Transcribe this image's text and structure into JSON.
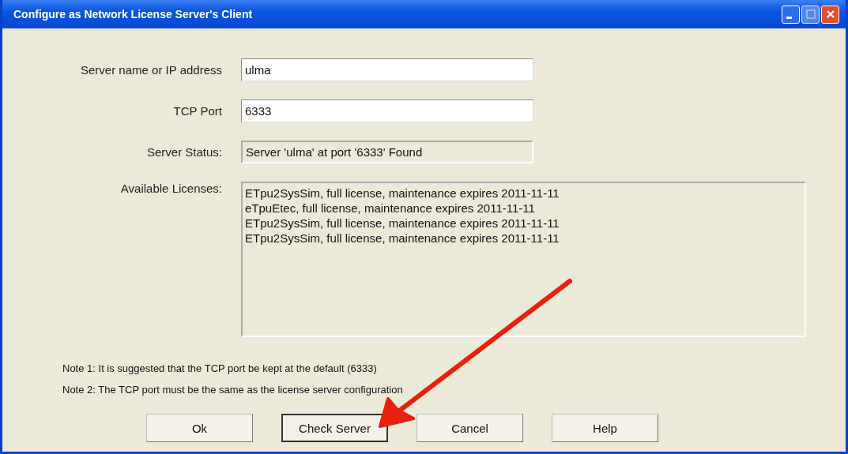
{
  "window": {
    "title": "Configure as Network License Server's Client"
  },
  "fields": [
    {
      "kind": "input",
      "label": "Server name or IP address",
      "value": "ulma"
    },
    {
      "kind": "input",
      "label": "TCP Port",
      "value": "6333"
    },
    {
      "kind": "readonly",
      "label": "Server Status:",
      "value": "Server 'ulma' at port '6333' Found"
    }
  ],
  "licenses": {
    "label": "Available Licenses:",
    "items": [
      "ETpu2SysSim, full license, maintenance expires 2011-11-11",
      "eTpuEtec, full license, maintenance expires 2011-11-11",
      "ETpu2SysSim, full license, maintenance expires 2011-11-11",
      "ETpu2SysSim, full license, maintenance expires 2011-11-11"
    ]
  },
  "notes": [
    "Note 1: It is suggested that the TCP port be kept at the default (6333)",
    "Note 2: The TCP port must be the same as the license server configuration"
  ],
  "buttons": [
    {
      "label": "Ok",
      "selected": false
    },
    {
      "label": "Check Server",
      "selected": true
    },
    {
      "label": "Cancel",
      "selected": false
    },
    {
      "label": "Help",
      "selected": false
    }
  ]
}
